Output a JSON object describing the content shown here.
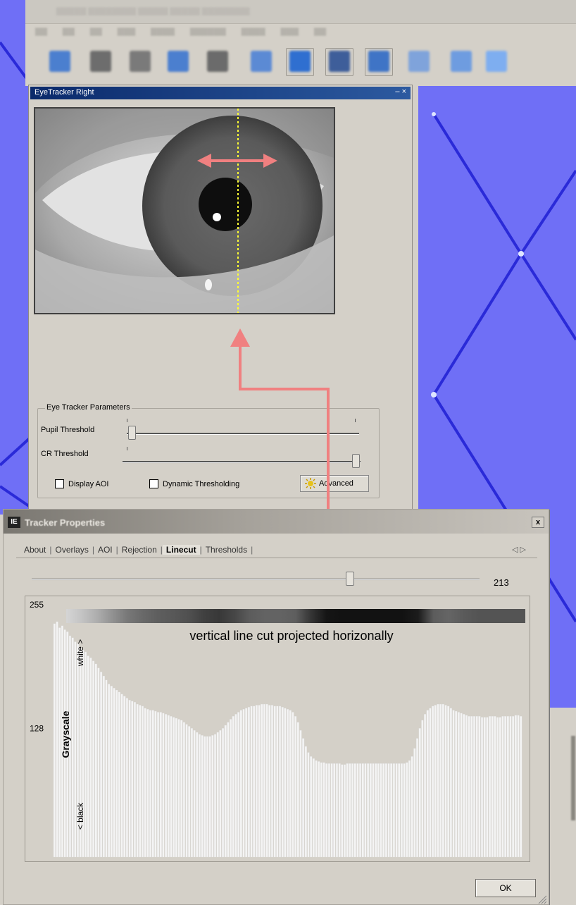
{
  "colors": {
    "desktop_blue": "#6f6ff6",
    "trace_blue": "#2a2ad8",
    "eye_titlebar": "#0b2a6b",
    "annotation_arrow": "#f08080",
    "cut_line": "#ffff33",
    "histogram_bar": "#f4f4f4"
  },
  "eye_tracker": {
    "title": "EyeTracker Right",
    "window_controls": "– ×",
    "params_title": "Eye Tracker Parameters",
    "pupil_threshold_label": "Pupil Threshold",
    "cr_threshold_label": "CR Threshold",
    "pupil_threshold_level": 0.02,
    "cr_threshold_level": 0.98,
    "display_aoi_label": "Display AOI",
    "display_aoi_checked": false,
    "dynamic_thresholding_label": "Dynamic Thresholding",
    "dynamic_thresholding_checked": false,
    "advanced_button": "Advanced",
    "advanced_icon": "gear-burst-icon"
  },
  "tracker_properties": {
    "icon_text": "IE",
    "title": "Tracker Properties",
    "close_label": "x",
    "tabs": [
      {
        "label": "About",
        "active": false
      },
      {
        "label": "Overlays",
        "active": false
      },
      {
        "label": "AOI",
        "active": false
      },
      {
        "label": "Rejection",
        "active": false
      },
      {
        "label": "Linecut",
        "active": true
      },
      {
        "label": "Thresholds",
        "active": false
      }
    ],
    "tab_scroll": "◁ ▷",
    "linecut_position": 213,
    "linecut_position_max": 300,
    "ok_button": "OK"
  },
  "chart_data": {
    "type": "bar",
    "title": "",
    "annotation": "vertical line cut projected horizonally",
    "ylabel": "Grayscale",
    "ylabel_top": "white >",
    "ylabel_bottom": "< black",
    "yticks": [
      "255",
      "128"
    ],
    "ylim": [
      0,
      255
    ],
    "values": [
      232,
      234,
      228,
      230,
      226,
      224,
      220,
      218,
      214,
      212,
      208,
      206,
      204,
      200,
      198,
      195,
      192,
      188,
      184,
      180,
      176,
      172,
      170,
      168,
      166,
      164,
      162,
      160,
      158,
      156,
      155,
      154,
      152,
      151,
      150,
      148,
      147,
      146,
      146,
      145,
      144,
      144,
      143,
      142,
      141,
      140,
      139,
      138,
      137,
      136,
      134,
      132,
      130,
      128,
      126,
      124,
      122,
      121,
      120,
      120,
      120,
      121,
      122,
      124,
      126,
      128,
      131,
      134,
      137,
      140,
      142,
      144,
      146,
      147,
      148,
      149,
      150,
      150,
      151,
      151,
      152,
      152,
      152,
      151,
      151,
      150,
      150,
      150,
      149,
      148,
      147,
      146,
      144,
      140,
      134,
      126,
      118,
      110,
      104,
      100,
      98,
      96,
      95,
      94,
      94,
      93,
      93,
      93,
      93,
      93,
      93,
      92,
      92,
      93,
      93,
      93,
      93,
      93,
      93,
      93,
      93,
      93,
      93,
      93,
      93,
      93,
      93,
      93,
      93,
      93,
      93,
      93,
      93,
      93,
      93,
      93,
      94,
      96,
      100,
      108,
      118,
      128,
      136,
      142,
      146,
      148,
      150,
      151,
      152,
      152,
      152,
      151,
      150,
      148,
      146,
      145,
      144,
      143,
      142,
      141,
      140,
      140,
      140,
      140,
      140,
      139,
      139,
      139,
      140,
      140,
      140,
      139,
      139,
      140,
      140,
      140,
      140,
      140,
      141,
      141,
      140
    ]
  }
}
